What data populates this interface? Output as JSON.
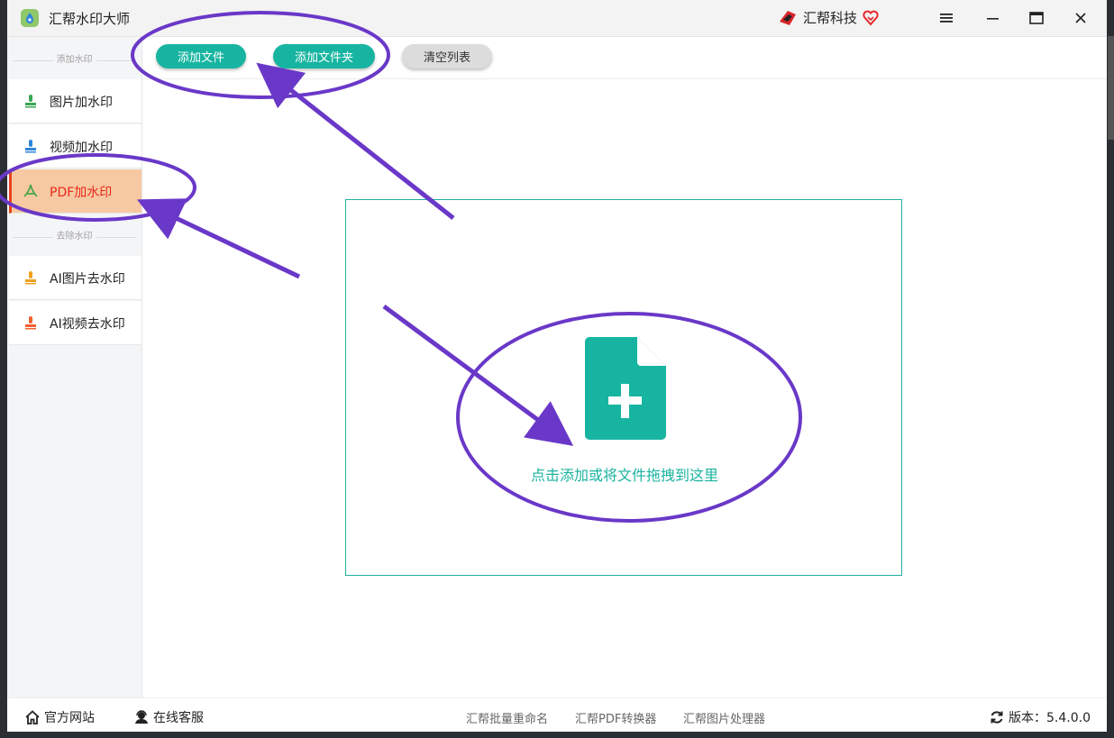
{
  "app": {
    "title": "汇帮水印大师",
    "brand": "汇帮科技"
  },
  "window_controls": {
    "menu": "menu-icon",
    "minimize": "minimize-icon",
    "maximize": "maximize-icon",
    "close": "close-icon"
  },
  "sidebar": {
    "section_add": "添加水印",
    "section_remove": "去除水印",
    "items": [
      {
        "label": "图片加水印",
        "icon": "image-watermark-icon",
        "color": "#3aa655"
      },
      {
        "label": "视频加水印",
        "icon": "video-watermark-icon",
        "color": "#2f86d8"
      },
      {
        "label": "PDF加水印",
        "icon": "pdf-icon",
        "color": "#4aa54a"
      },
      {
        "label": "AI图片去水印",
        "icon": "ai-image-remove-icon",
        "color": "#f0a020"
      },
      {
        "label": "AI视频去水印",
        "icon": "ai-video-remove-icon",
        "color": "#f06030"
      }
    ]
  },
  "toolbar": {
    "add_file": "添加文件",
    "add_folder": "添加文件夹",
    "clear_list": "清空列表"
  },
  "dropzone": {
    "text": "点击添加或将文件拖拽到这里"
  },
  "footer": {
    "website": "官方网站",
    "support": "在线客服",
    "link1": "汇帮批量重命名",
    "link2": "汇帮PDF转换器",
    "link3": "汇帮图片处理器",
    "version": "版本：5.4.0.0"
  },
  "colors": {
    "accent": "#17b5a1",
    "active_bg": "#f6c9a2",
    "active_text": "#e8281a",
    "annotation": "#6a38c8"
  }
}
